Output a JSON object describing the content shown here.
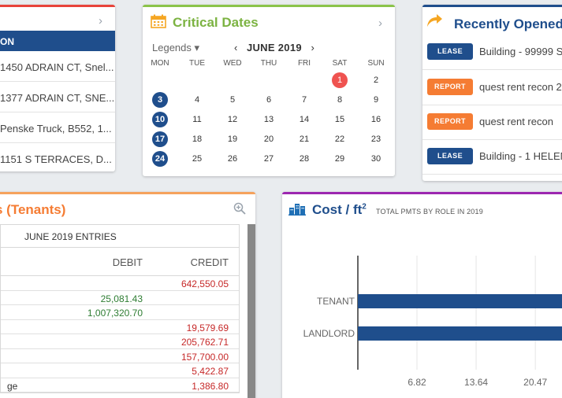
{
  "left_card": {
    "selected": "ON",
    "rows": [
      "1450 ADRAIN CT, Snel...",
      "1377 ADRAIN CT, SNE...",
      "Penske Truck, B552, 1...",
      "1151 S TERRACES, D..."
    ]
  },
  "critical_dates": {
    "title": "Critical Dates",
    "legends_label": "Legends ▾",
    "prev": "‹",
    "month_label": "JUNE  2019",
    "next": "›",
    "dow": [
      "MON",
      "TUE",
      "WED",
      "THU",
      "FRI",
      "SAT",
      "SUN"
    ],
    "weeks": [
      [
        null,
        null,
        null,
        null,
        null,
        "1",
        "2"
      ],
      [
        "3",
        "4",
        "5",
        "6",
        "7",
        "8",
        "9"
      ],
      [
        "10",
        "11",
        "12",
        "13",
        "14",
        "15",
        "16"
      ],
      [
        "17",
        "18",
        "19",
        "20",
        "21",
        "22",
        "23"
      ],
      [
        "24",
        "25",
        "26",
        "27",
        "28",
        "29",
        "30"
      ]
    ],
    "highlighted_days": [
      "3",
      "10",
      "17",
      "24"
    ],
    "today": "1"
  },
  "recently_opened": {
    "title": "Recently Opened",
    "items": [
      {
        "type": "LEASE",
        "kind": "lease",
        "text": "Building - 99999 S"
      },
      {
        "type": "REPORT",
        "kind": "report",
        "text": "quest rent recon 2"
      },
      {
        "type": "REPORT",
        "kind": "report",
        "text": "quest rent recon"
      },
      {
        "type": "LEASE",
        "kind": "lease",
        "text": "Building - 1 HELEN"
      }
    ]
  },
  "ledger": {
    "title": "s (Tenants)",
    "month_header": "JUNE 2019 ENTRIES",
    "debit_header": "DEBIT",
    "credit_header": "CREDIT",
    "rows": [
      {
        "label": "",
        "debit": "",
        "credit": "642,550.05"
      },
      {
        "label": "",
        "debit": "25,081.43",
        "credit": ""
      },
      {
        "label": "",
        "debit": "1,007,320.70",
        "credit": ""
      },
      {
        "label": "",
        "debit": "",
        "credit": "19,579.69"
      },
      {
        "label": "",
        "debit": "",
        "credit": "205,762.71"
      },
      {
        "label": "",
        "debit": "",
        "credit": "157,700.00"
      },
      {
        "label": "",
        "debit": "",
        "credit": "5,422.87"
      },
      {
        "label": "ge",
        "debit": "",
        "credit": "1,386.80"
      }
    ]
  },
  "cost": {
    "title": "Cost / ft",
    "title_sup": "2",
    "subtitle": "TOTAL PMTS BY ROLE IN 2019"
  },
  "chart_data": {
    "type": "bar",
    "orientation": "horizontal",
    "categories": [
      "TENANT",
      "LANDLORD"
    ],
    "values": [
      30,
      30
    ],
    "xticks": [
      "6.82",
      "13.64",
      "20.47"
    ],
    "xtick_values": [
      6.82,
      13.64,
      20.47
    ],
    "colors": {
      "bar": "#1f4e8c",
      "grid": "#e5e5e5",
      "axis": "#333333"
    }
  }
}
